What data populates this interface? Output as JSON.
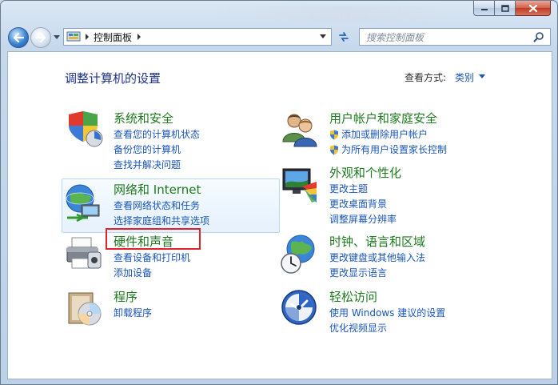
{
  "window": {
    "title": ""
  },
  "nav": {
    "breadcrumb": "控制面板",
    "search_placeholder": "搜索控制面板"
  },
  "page": {
    "title": "调整计算机的设置",
    "view_by_label": "查看方式:",
    "view_by_value": "类别"
  },
  "categories": {
    "system": {
      "title": "系统和安全",
      "links": [
        "查看您的计算机状态",
        "备份您的计算机",
        "查找并解决问题"
      ]
    },
    "network": {
      "title": "网络和 Internet",
      "links": [
        "查看网络状态和任务",
        "选择家庭组和共享选项"
      ]
    },
    "hardware": {
      "title": "硬件和声音",
      "links": [
        "查看设备和打印机",
        "添加设备"
      ]
    },
    "programs": {
      "title": "程序",
      "links": [
        "卸载程序"
      ]
    },
    "users": {
      "title": "用户帐户和家庭安全",
      "links": [
        "添加或删除用户帐户",
        "为所有用户设置家长控制"
      ]
    },
    "appearance": {
      "title": "外观和个性化",
      "links": [
        "更改主题",
        "更改桌面背景",
        "调整屏幕分辨率"
      ]
    },
    "clock": {
      "title": "时钟、语言和区域",
      "links": [
        "更改键盘或其他输入法",
        "更改显示语言"
      ]
    },
    "ease": {
      "title": "轻松访问",
      "links": [
        "使用 Windows 建议的设置",
        "优化视频显示"
      ]
    }
  },
  "colors": {
    "link": "#1a56b8",
    "category_title": "#1e7a1e",
    "page_title": "#1e3287",
    "highlight_box": "#e0222a"
  }
}
